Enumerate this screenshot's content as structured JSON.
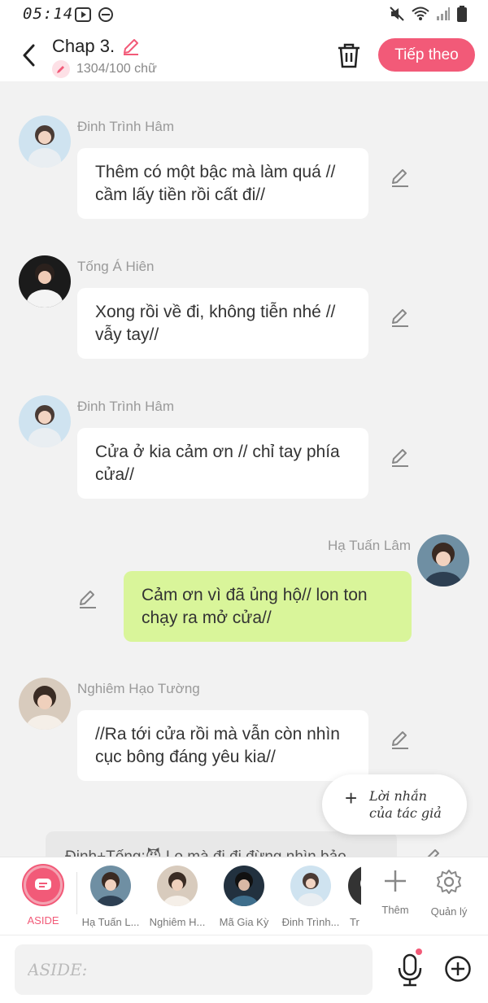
{
  "status_bar": {
    "time": "05:14"
  },
  "header": {
    "title": "Chap 3.",
    "word_count": "1304/100 chữ",
    "next_label": "Tiếp theo"
  },
  "messages": [
    {
      "name": "Đinh Trình Hâm",
      "text": "Thêm có một bậc mà làm quá // cầm lấy tiền rồi cất đi//",
      "side": "left"
    },
    {
      "name": "Tống Á Hiên",
      "text": "Xong rồi về đi, không tiễn nhé // vẫy tay//",
      "side": "left"
    },
    {
      "name": "Đinh Trình Hâm",
      "text": "Cửa ở kia cảm ơn // chỉ tay phía cửa//",
      "side": "left"
    },
    {
      "name": "Hạ Tuấn Lâm",
      "text": "Cảm ơn vì đã ủng hộ// lon ton chạy ra mở cửa//",
      "side": "right"
    },
    {
      "name": "Nghiêm Hạo Tường",
      "text": "//Ra tới cửa rồi mà vẫn còn nhìn cục bông đáng yêu kia//",
      "side": "left"
    }
  ],
  "peek_message": "Đinh+Tống:😈 Lo mà đi đi đừng nhìn bảo",
  "author_note_button": {
    "line1": "Lời nhắn",
    "line2": "của tác giả"
  },
  "character_bar": {
    "aside_label": "ASIDE",
    "characters": [
      "Hạ Tuấn L...",
      "Nghiêm H...",
      "Mã Gia Kỳ",
      "Đinh Trình...",
      "Tr"
    ],
    "add_label": "Thêm",
    "manage_label": "Quản lý"
  },
  "input": {
    "placeholder": "ASIDE:"
  },
  "colors": {
    "accent": "#f25a78",
    "my_bubble": "#d9f59a",
    "background": "#f2f2f2"
  }
}
